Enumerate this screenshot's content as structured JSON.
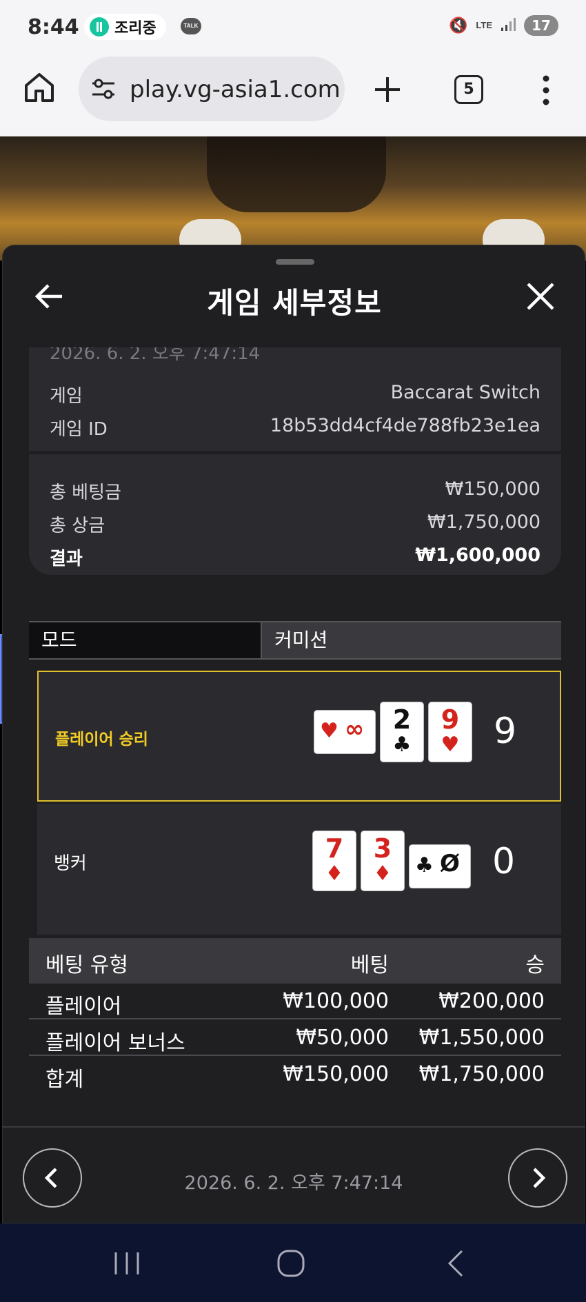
{
  "status_bar": {
    "time": "8:44",
    "notification_text": "조리중",
    "talk_badge": "TALK",
    "network_label": "LTE",
    "battery": "17"
  },
  "browser": {
    "url": "play.vg-asia1.com",
    "tab_count": "5"
  },
  "sheet": {
    "title": "게임 세부정보",
    "partial_date": "2026. 6. 2. 오후 7:47:14",
    "game_label": "게임",
    "game_value": "Baccarat Switch",
    "game_id_label": "게임 ID",
    "game_id_value": "18b53dd4cf4de788fb23e1ea",
    "total_bet_label": "총 베팅금",
    "total_bet_value": "₩150,000",
    "total_prize_label": "총 상금",
    "total_prize_value": "₩1,750,000",
    "result_label": "결과",
    "result_value": "₩1,600,000"
  },
  "mode": {
    "label": "모드",
    "value": "커미션"
  },
  "hands": {
    "player": {
      "label": "플레이어 승리",
      "score": "9",
      "cards": [
        {
          "rank": "∞",
          "suit": "♥",
          "color": "red",
          "side": true
        },
        {
          "rank": "2",
          "suit": "♣",
          "color": "black",
          "side": false
        },
        {
          "rank": "9",
          "suit": "♥",
          "color": "red",
          "side": false
        }
      ]
    },
    "banker": {
      "label": "뱅커",
      "score": "0",
      "cards": [
        {
          "rank": "7",
          "suit": "♦",
          "color": "red",
          "side": false
        },
        {
          "rank": "3",
          "suit": "♦",
          "color": "red",
          "side": false
        },
        {
          "rank": "Ø",
          "suit": "♣",
          "color": "black",
          "side": true
        }
      ]
    }
  },
  "bets_table": {
    "headers": [
      "베팅 유형",
      "베팅",
      "승"
    ],
    "rows": [
      [
        "플레이어",
        "₩100,000",
        "₩200,000"
      ],
      [
        "플레이어 보너스",
        "₩50,000",
        "₩1,550,000"
      ],
      [
        "합계",
        "₩150,000",
        "₩1,750,000"
      ]
    ]
  },
  "footer": {
    "date": "2026. 6. 2. 오후 7:47:14"
  },
  "colors": {
    "accent_gold": "#e1c12b",
    "sheet_bg": "#1f1e21",
    "card_red": "#d3231c"
  }
}
